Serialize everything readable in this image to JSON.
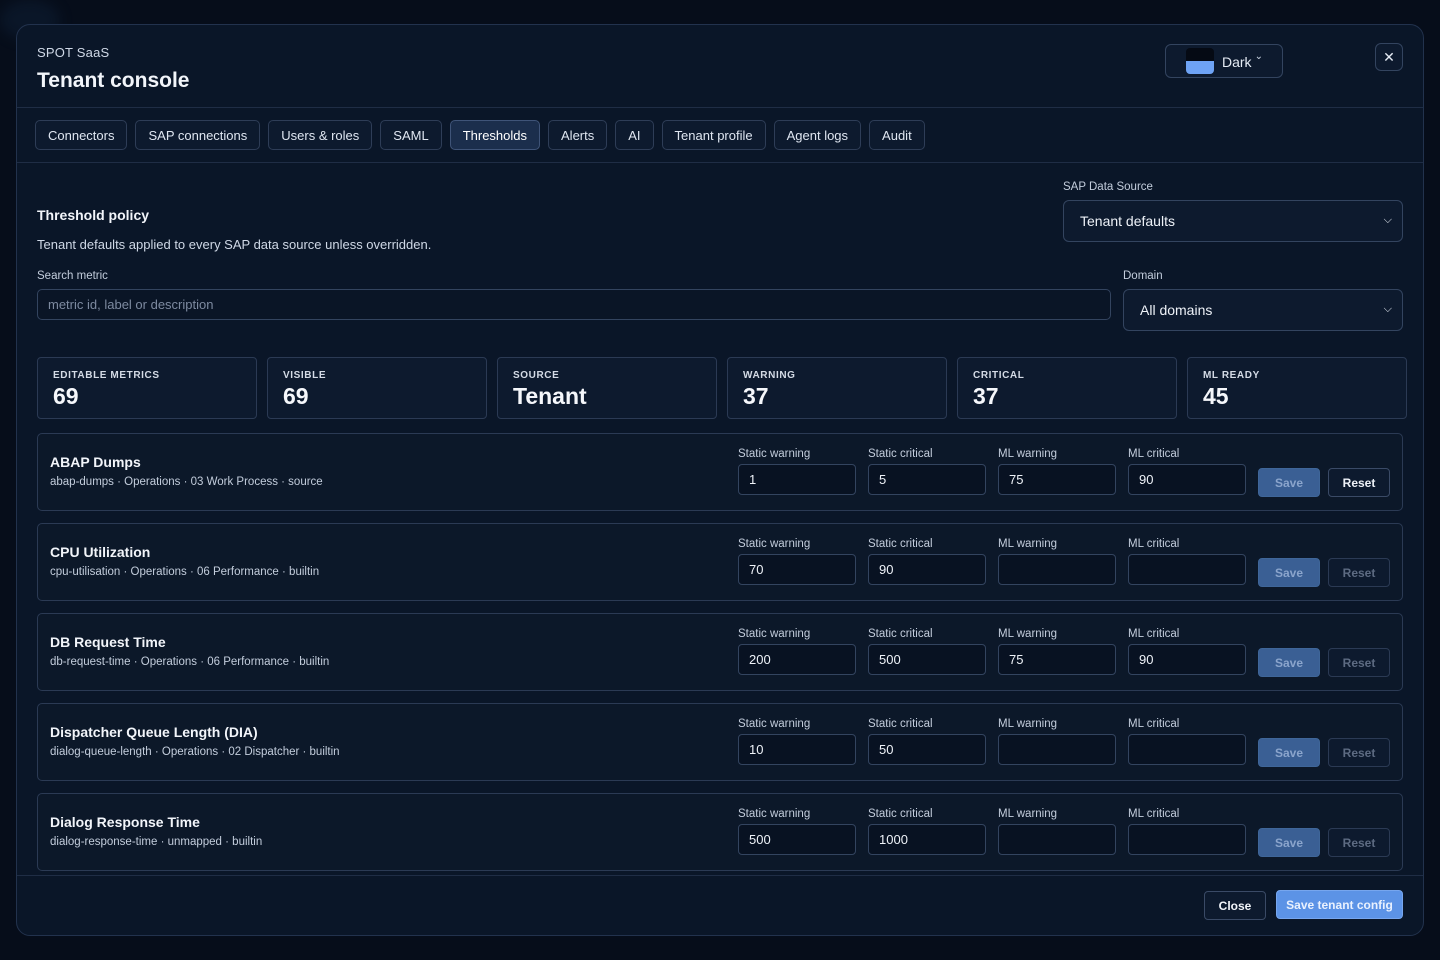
{
  "header": {
    "brand": "SPOT SaaS",
    "title": "Tenant console",
    "theme": {
      "label": "Dark",
      "swatch_top": "#050a14",
      "swatch_bottom": "#6ea3f5"
    },
    "close_icon": "close-icon"
  },
  "tabs": [
    {
      "label": "Connectors",
      "active": false
    },
    {
      "label": "SAP connections",
      "active": false
    },
    {
      "label": "Users & roles",
      "active": false
    },
    {
      "label": "SAML",
      "active": false
    },
    {
      "label": "Thresholds",
      "active": true
    },
    {
      "label": "Alerts",
      "active": false
    },
    {
      "label": "AI",
      "active": false
    },
    {
      "label": "Tenant profile",
      "active": false
    },
    {
      "label": "Agent logs",
      "active": false
    },
    {
      "label": "Audit",
      "active": false
    }
  ],
  "policy": {
    "title": "Threshold policy",
    "description": "Tenant defaults applied to every SAP data source unless overridden.",
    "data_source": {
      "label": "SAP Data Source",
      "value": "Tenant defaults"
    },
    "search": {
      "label": "Search metric",
      "value": "",
      "placeholder": "metric id, label or description"
    },
    "domain": {
      "label": "Domain",
      "value": "All domains"
    }
  },
  "stats": [
    {
      "label": "EDITABLE METRICS",
      "value": "69"
    },
    {
      "label": "VISIBLE",
      "value": "69"
    },
    {
      "label": "SOURCE",
      "value": "Tenant"
    },
    {
      "label": "WARNING",
      "value": "37"
    },
    {
      "label": "CRITICAL",
      "value": "37"
    },
    {
      "label": "ML READY",
      "value": "45"
    }
  ],
  "field_labels": {
    "static_warning": "Static warning",
    "static_critical": "Static critical",
    "ml_warning": "ML warning",
    "ml_critical": "ML critical",
    "save": "Save",
    "reset": "Reset"
  },
  "metrics": [
    {
      "name": "ABAP Dumps",
      "meta": "abap-dumps · Operations · 03 Work Process · source",
      "static_warning": "1",
      "static_critical": "5",
      "ml_warning": "75",
      "ml_critical": "90",
      "reset_enabled": true
    },
    {
      "name": "CPU Utilization",
      "meta": "cpu-utilisation · Operations · 06 Performance · builtin",
      "static_warning": "70",
      "static_critical": "90",
      "ml_warning": "",
      "ml_critical": "",
      "reset_enabled": false
    },
    {
      "name": "DB Request Time",
      "meta": "db-request-time · Operations · 06 Performance · builtin",
      "static_warning": "200",
      "static_critical": "500",
      "ml_warning": "75",
      "ml_critical": "90",
      "reset_enabled": false
    },
    {
      "name": "Dispatcher Queue Length (DIA)",
      "meta": "dialog-queue-length · Operations · 02 Dispatcher · builtin",
      "static_warning": "10",
      "static_critical": "50",
      "ml_warning": "",
      "ml_critical": "",
      "reset_enabled": false
    },
    {
      "name": "Dialog Response Time",
      "meta": "dialog-response-time · unmapped · builtin",
      "static_warning": "500",
      "static_critical": "1000",
      "ml_warning": "",
      "ml_critical": "",
      "reset_enabled": false
    }
  ],
  "footer": {
    "close_label": "Close",
    "save_label": "Save tenant config"
  }
}
